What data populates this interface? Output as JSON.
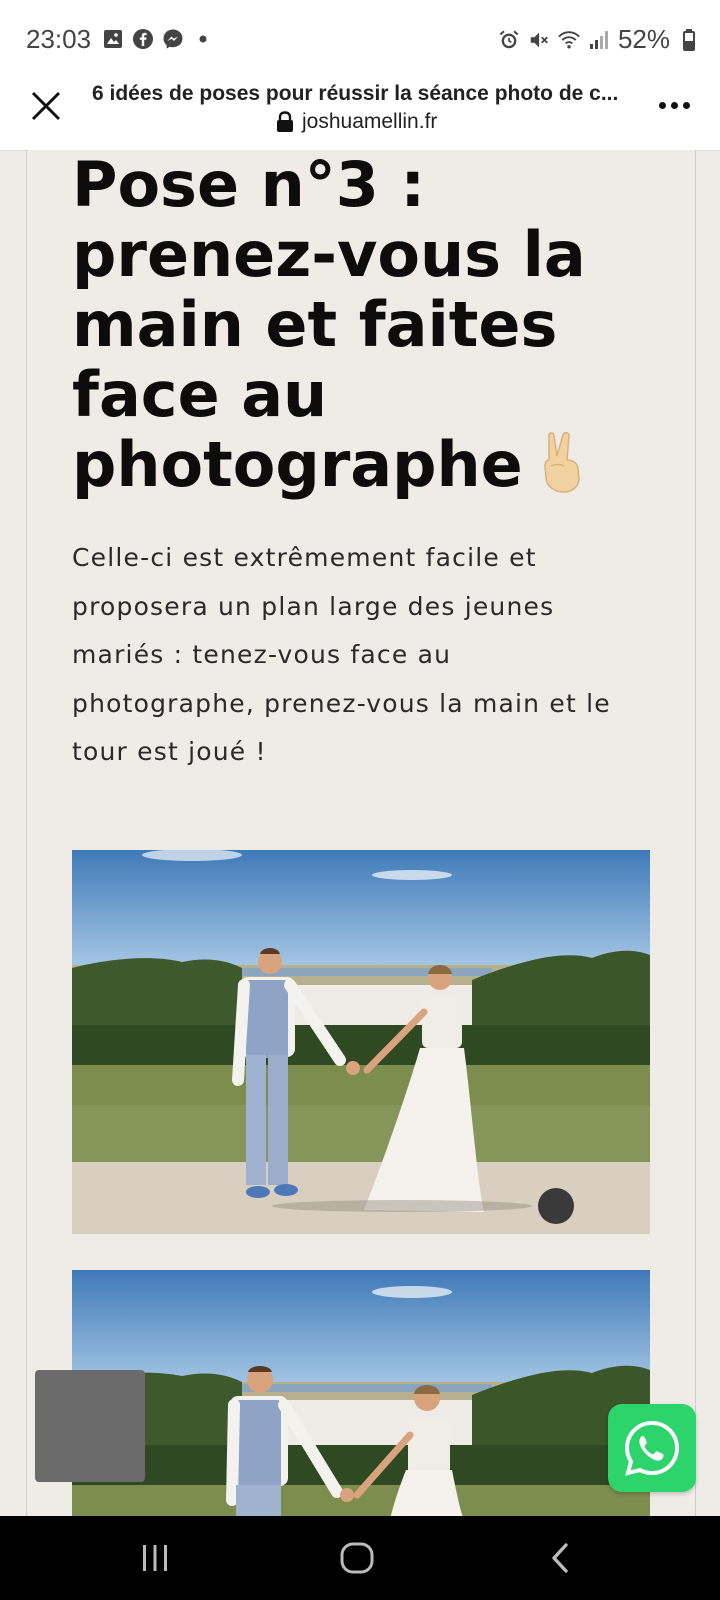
{
  "status_bar": {
    "time": "23:03",
    "battery": "52%",
    "left_icons": [
      "image-icon",
      "facebook-icon",
      "messenger-icon",
      "dot-icon"
    ],
    "right_icons": [
      "alarm-icon",
      "mute-icon",
      "wifi-icon",
      "signal-icon",
      "battery-icon"
    ]
  },
  "browser": {
    "title": "6 idées de poses pour réussir la séance photo de c...",
    "domain": "joshuamellin.fr"
  },
  "article": {
    "heading_lines": [
      "Pose n°3 :",
      "prenez-vous la",
      "main et faites",
      "face au",
      "photographe"
    ],
    "heading_emoji": "victory-hand-icon",
    "paragraph_lines": [
      "Celle-ci est extrêmement facile et",
      "proposera un plan large des jeunes",
      "mariés : tenez-vous face au",
      "photographe, prenez-vous la main et le",
      "tour est joué !"
    ]
  },
  "colors": {
    "page_bg": "#efebe6",
    "whatsapp": "#2cd46b",
    "heading": "#0c0c0c"
  }
}
